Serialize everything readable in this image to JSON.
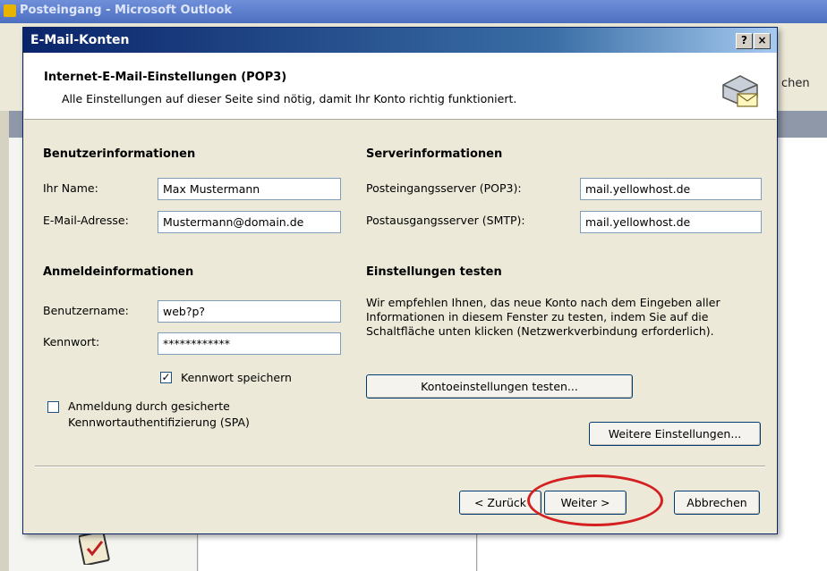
{
  "background_window": {
    "title": "Posteingang - Microsoft Outlook",
    "toolbar_fragment": "chen"
  },
  "dialog": {
    "title": "E-Mail-Konten",
    "help_button": "?",
    "close_button": "×",
    "header_title": "Internet-E-Mail-Einstellungen (POP3)",
    "header_subtitle": "Alle Einstellungen auf dieser Seite sind nötig, damit Ihr Konto richtig funktioniert."
  },
  "user_info": {
    "heading": "Benutzerinformationen",
    "name_label": "Ihr Name:",
    "name_value": "Max Mustermann",
    "email_label": "E-Mail-Adresse:",
    "email_value": "Mustermann@domain.de"
  },
  "server_info": {
    "heading": "Serverinformationen",
    "incoming_label": "Posteingangsserver (POP3):",
    "incoming_value": "mail.yellowhost.de",
    "outgoing_label": "Postausgangsserver (SMTP):",
    "outgoing_value": "mail.yellowhost.de"
  },
  "login_info": {
    "heading": "Anmeldeinformationen",
    "username_label": "Benutzername:",
    "username_value": "web?p?",
    "password_label": "Kennwort:",
    "password_value": "************",
    "save_password_label": "Kennwort speichern",
    "save_password_checked": true,
    "spa_label_line1": "Anmeldung durch gesicherte",
    "spa_label_line2": "Kennwortauthentifizierung (SPA)",
    "spa_checked": false
  },
  "test_settings": {
    "heading": "Einstellungen testen",
    "description": "Wir empfehlen Ihnen, das neue Konto nach dem Eingeben aller Informationen in diesem Fenster zu testen, indem Sie auf die Schaltfläche unten klicken (Netzwerkverbindung erforderlich).",
    "test_button": "Kontoeinstellungen testen...",
    "more_settings_button": "Weitere Einstellungen..."
  },
  "footer": {
    "back_button": "< Zurück",
    "next_button": "Weiter >",
    "cancel_button": "Abbrechen"
  },
  "colors": {
    "highlight_ellipse": "#d42020",
    "title_bar": "#0a246a",
    "dialog_face": "#ece9d8"
  },
  "icons": {
    "header": "mail-account-icon",
    "background": "clipboard-icon"
  }
}
